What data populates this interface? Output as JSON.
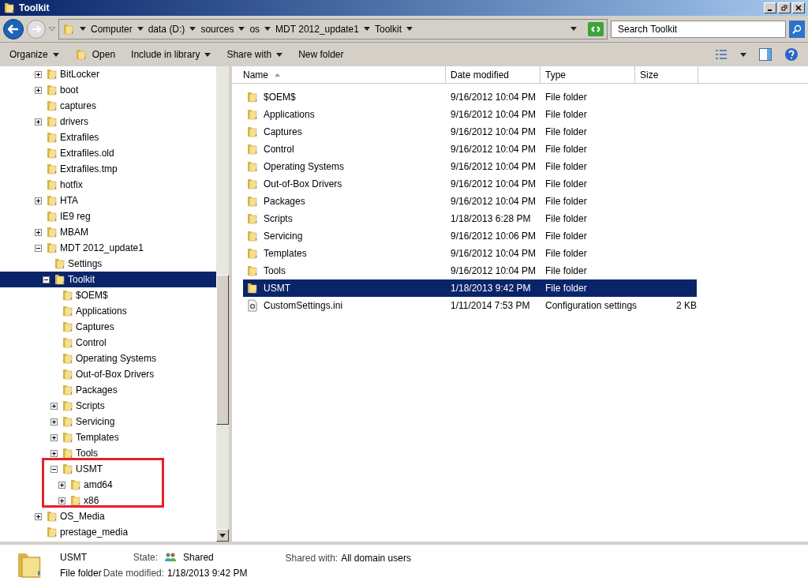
{
  "window": {
    "title": "Toolkit"
  },
  "address_bar": {
    "segments": [
      "Computer",
      "data (D:)",
      "sources",
      "os",
      "MDT 2012_update1",
      "Toolkit"
    ]
  },
  "search": {
    "placeholder": "Search Toolkit"
  },
  "toolbar": [
    {
      "label": "Organize",
      "dropdown": true,
      "kind": "text"
    },
    {
      "label": "Open",
      "dropdown": false,
      "kind": "icon"
    },
    {
      "label": "Include in library",
      "dropdown": true,
      "kind": "text"
    },
    {
      "label": "Share with",
      "dropdown": true,
      "kind": "text"
    },
    {
      "label": "New folder",
      "dropdown": false,
      "kind": "text"
    }
  ],
  "tree": [
    {
      "label": "BitLocker",
      "expanded": false,
      "selected": false
    },
    {
      "label": "boot",
      "expanded": false,
      "selected": false
    },
    {
      "label": "captures",
      "selected": false
    },
    {
      "label": "drivers",
      "expanded": false,
      "selected": false
    },
    {
      "label": "Extrafiles",
      "selected": false
    },
    {
      "label": "Extrafiles.old",
      "selected": false
    },
    {
      "label": "Extrafiles.tmp",
      "selected": false
    },
    {
      "label": "hotfix",
      "selected": false
    },
    {
      "label": "HTA",
      "expanded": false,
      "selected": false
    },
    {
      "label": "IE9 reg",
      "selected": false
    },
    {
      "label": "MBAM",
      "expanded": false,
      "selected": false
    },
    {
      "label": "MDT 2012_update1",
      "expanded": true,
      "selected": false,
      "children": [
        {
          "label": "Settings",
          "selected": false
        },
        {
          "label": "Toolkit",
          "expanded": true,
          "selected": true,
          "children": [
            {
              "label": "$OEM$",
              "selected": false
            },
            {
              "label": "Applications",
              "selected": false
            },
            {
              "label": "Captures",
              "selected": false
            },
            {
              "label": "Control",
              "selected": false
            },
            {
              "label": "Operating Systems",
              "selected": false
            },
            {
              "label": "Out-of-Box Drivers",
              "selected": false
            },
            {
              "label": "Packages",
              "selected": false
            },
            {
              "label": "Scripts",
              "expanded": false,
              "selected": false
            },
            {
              "label": "Servicing",
              "expanded": false,
              "selected": false
            },
            {
              "label": "Templates",
              "expanded": false,
              "selected": false
            },
            {
              "label": "Tools",
              "expanded": false,
              "selected": false
            },
            {
              "label": "USMT",
              "expanded": true,
              "selected": false,
              "children": [
                {
                  "label": "amd64",
                  "expanded": false,
                  "selected": false
                },
                {
                  "label": "x86",
                  "expanded": false,
                  "selected": false
                }
              ]
            }
          ]
        }
      ]
    },
    {
      "label": "OS_Media",
      "expanded": false,
      "selected": false
    },
    {
      "label": "prestage_media",
      "selected": false
    }
  ],
  "columns": [
    {
      "label": "Name",
      "sorted": true
    },
    {
      "label": "Date modified",
      "sorted": false
    },
    {
      "label": "Type",
      "sorted": false
    },
    {
      "label": "Size",
      "sorted": false
    }
  ],
  "rows": [
    {
      "kind": "folder",
      "name": "$OEM$",
      "date": "9/16/2012 10:04 PM",
      "type": "File folder",
      "selected": false
    },
    {
      "kind": "folder",
      "name": "Applications",
      "date": "9/16/2012 10:04 PM",
      "type": "File folder",
      "selected": false
    },
    {
      "kind": "folder",
      "name": "Captures",
      "date": "9/16/2012 10:04 PM",
      "type": "File folder",
      "selected": false
    },
    {
      "kind": "folder",
      "name": "Control",
      "date": "9/16/2012 10:04 PM",
      "type": "File folder",
      "selected": false
    },
    {
      "kind": "folder",
      "name": "Operating Systems",
      "date": "9/16/2012 10:04 PM",
      "type": "File folder",
      "selected": false
    },
    {
      "kind": "folder",
      "name": "Out-of-Box Drivers",
      "date": "9/16/2012 10:04 PM",
      "type": "File folder",
      "selected": false
    },
    {
      "kind": "folder",
      "name": "Packages",
      "date": "9/16/2012 10:04 PM",
      "type": "File folder",
      "selected": false
    },
    {
      "kind": "folder",
      "name": "Scripts",
      "date": "1/18/2013 6:28 PM",
      "type": "File folder",
      "selected": false
    },
    {
      "kind": "folder",
      "name": "Servicing",
      "date": "9/16/2012 10:06 PM",
      "type": "File folder",
      "selected": false
    },
    {
      "kind": "folder",
      "name": "Templates",
      "date": "9/16/2012 10:04 PM",
      "type": "File folder",
      "selected": false
    },
    {
      "kind": "folder",
      "name": "Tools",
      "date": "9/16/2012 10:04 PM",
      "type": "File folder",
      "selected": false
    },
    {
      "kind": "folder",
      "name": "USMT",
      "date": "1/18/2013 9:42 PM",
      "type": "File folder",
      "selected": true
    },
    {
      "kind": "settings",
      "name": "CustomSettings.ini",
      "date": "1/11/2014 7:53 PM",
      "type": "Configuration settings",
      "size": "2 KB",
      "selected": false
    }
  ],
  "details": {
    "name": "USMT",
    "type": "File folder",
    "state_label": "State:",
    "state": "Shared",
    "date_label": "Date modified:",
    "date": "1/18/2013 9:42 PM",
    "shared_label": "Shared with:",
    "shared": "All domain users"
  }
}
